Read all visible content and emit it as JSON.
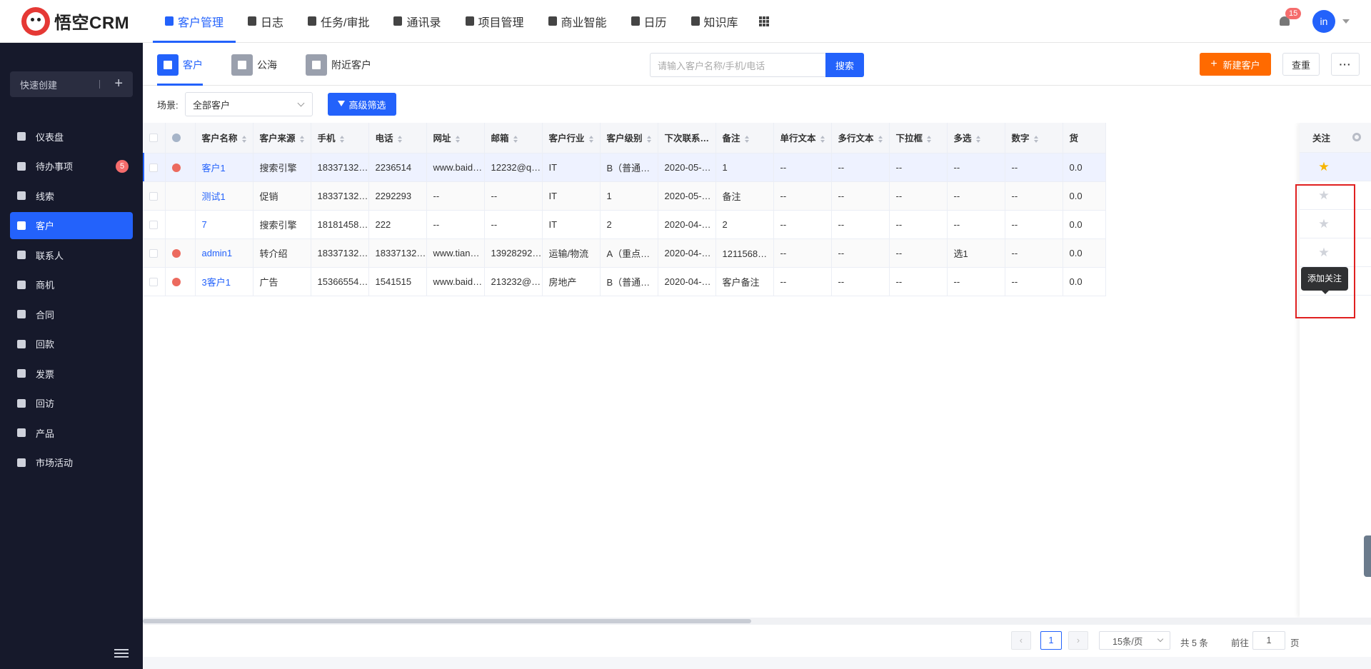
{
  "app": {
    "logo_text": "悟空CRM"
  },
  "nav": [
    {
      "label": "客户管理",
      "icon": "customer-icon",
      "active": true
    },
    {
      "label": "日志",
      "icon": "log-icon"
    },
    {
      "label": "任务/审批",
      "icon": "briefcase-icon"
    },
    {
      "label": "通讯录",
      "icon": "phone-book-icon"
    },
    {
      "label": "项目管理",
      "icon": "project-icon"
    },
    {
      "label": "商业智能",
      "icon": "bi-icon"
    },
    {
      "label": "日历",
      "icon": "calendar-icon"
    },
    {
      "label": "知识库",
      "icon": "book-icon"
    }
  ],
  "user": {
    "notification_count": "15",
    "avatar_text": "in"
  },
  "sidebar": {
    "quick_create": "快速创建",
    "items": [
      {
        "label": "仪表盘",
        "icon": "dashboard-icon"
      },
      {
        "label": "待办事项",
        "icon": "todo-icon",
        "count": "5"
      },
      {
        "label": "线索",
        "icon": "lead-icon"
      },
      {
        "label": "客户",
        "icon": "customer-icon",
        "active": true
      },
      {
        "label": "联系人",
        "icon": "contact-icon"
      },
      {
        "label": "商机",
        "icon": "business-icon"
      },
      {
        "label": "合同",
        "icon": "contract-icon"
      },
      {
        "label": "回款",
        "icon": "payment-icon"
      },
      {
        "label": "发票",
        "icon": "invoice-icon"
      },
      {
        "label": "回访",
        "icon": "visit-icon"
      },
      {
        "label": "产品",
        "icon": "product-icon"
      },
      {
        "label": "市场活动",
        "icon": "campaign-icon"
      }
    ]
  },
  "tabs": {
    "customer": "客户",
    "sea": "公海",
    "nearby": "附近客户"
  },
  "search": {
    "placeholder": "请输入客户名称/手机/电话",
    "button": "搜索"
  },
  "toolbar": {
    "new_label": "新建客户",
    "check_label": "查重",
    "more_label": "···"
  },
  "filter": {
    "scene_label": "场景:",
    "scene_value": "全部客户",
    "advanced_label": "高级筛选"
  },
  "table": {
    "columns": [
      "客户名称",
      "客户来源",
      "手机",
      "电话",
      "网址",
      "邮箱",
      "客户行业",
      "客户级别",
      "下次联系时…",
      "备注",
      "单行文本",
      "多行文本",
      "下拉框",
      "多选",
      "数字",
      "货"
    ],
    "rows": [
      {
        "deal": true,
        "cells": [
          "客户1",
          "搜索引擎",
          "183371322…",
          "2236514",
          "www.baidu…",
          "12232@qq…",
          "IT",
          "B（普通客…",
          "2020-05-1…",
          "1",
          "--",
          "--",
          "--",
          "--",
          "--",
          "0.0"
        ],
        "followed": true
      },
      {
        "deal": false,
        "cells": [
          "测试1",
          "促销",
          "183371322…",
          "2292293",
          "--",
          "--",
          "IT",
          "1",
          "2020-05-2…",
          "备注",
          "--",
          "--",
          "--",
          "--",
          "--",
          "0.0"
        ],
        "followed": false
      },
      {
        "deal": false,
        "cells": [
          "7",
          "搜索引擎",
          "1818145816",
          "222",
          "--",
          "--",
          "IT",
          "2",
          "2020-04-2…",
          "2",
          "--",
          "--",
          "--",
          "--",
          "--",
          "0.0"
        ],
        "followed": false
      },
      {
        "deal": true,
        "cells": [
          "admin1",
          "转介绍",
          "183371322…",
          "183371322…",
          "www.tianya…",
          "139282925…",
          "运输/物流",
          "A（重点客…",
          "2020-04-2…",
          "1211568备注",
          "--",
          "--",
          "--",
          "选1",
          "--",
          "0.0"
        ],
        "followed": false
      },
      {
        "deal": true,
        "cells": [
          "3客户1",
          "广告",
          "153665545…",
          "1541515",
          "www.baidu…",
          "213232@q…",
          "房地产",
          "B（普通客…",
          "2020-04-2…",
          "客户备注",
          "--",
          "--",
          "--",
          "--",
          "--",
          "0.0"
        ],
        "followed": false
      }
    ],
    "follow_header": "关注",
    "tooltip": "添加关注"
  },
  "pager": {
    "current": "1",
    "page_size": "15条/页",
    "total": "共 5 条",
    "goto_label": "前往",
    "goto_value": "1",
    "page_label": "页"
  }
}
